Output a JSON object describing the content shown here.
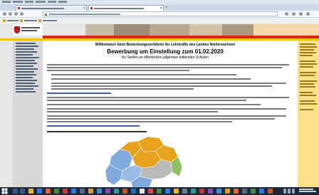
{
  "browser": {
    "tabs_count": 2,
    "new_tab_glyph": "+"
  },
  "page": {
    "title_line1": "Willkommen beim Bewerbungsverfahren für Lehrkräfte des Landes Niedersachsen",
    "title_line2": "Bewerbung um Einstellung zum 01.02.2020",
    "title_line3": "für Stellen an öffentlichen allgemein bildenden Schulen"
  },
  "colors": {
    "header_red": "#d9261c",
    "header_yellow": "#f1c40f",
    "right_column": "#fbe28a",
    "link_blue": "#3a5fb0",
    "map_orange": "#e8a11a",
    "map_blue": "#7fa8dc",
    "map_green": "#8cc060",
    "map_gray": "#b9b9b9"
  },
  "icons": {
    "logo": "coat-of-arms-icon",
    "start": "windows-start-icon"
  }
}
